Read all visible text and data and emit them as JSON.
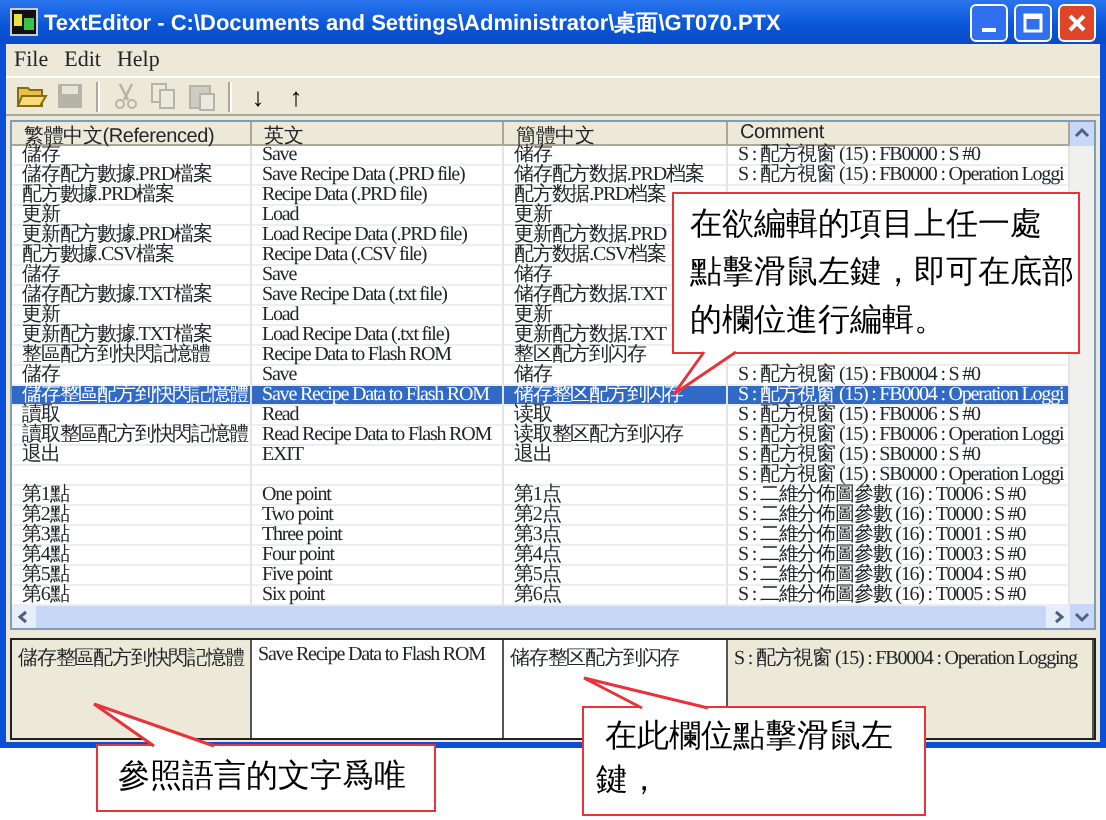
{
  "window": {
    "title": "TextEditor - C:\\Documents and Settings\\Administrator\\桌面\\GT070.PTX"
  },
  "menu": [
    {
      "label": "File"
    },
    {
      "label": "Edit"
    },
    {
      "label": "Help"
    }
  ],
  "toolbar": [
    {
      "kind": "open",
      "disabled": false
    },
    {
      "kind": "save",
      "disabled": true
    },
    {
      "kind": "separator"
    },
    {
      "kind": "cut",
      "disabled": true
    },
    {
      "kind": "copy",
      "disabled": true
    },
    {
      "kind": "paste",
      "disabled": true
    },
    {
      "kind": "separator"
    },
    {
      "kind": "text",
      "label": "↓",
      "disabled": false
    },
    {
      "kind": "text",
      "label": "↑",
      "disabled": false
    }
  ],
  "table": {
    "columns": [
      "繁體中文(Referenced)",
      "英文",
      "簡體中文",
      "Comment"
    ],
    "rows": [
      {
        "selected": false,
        "ref": "儲存",
        "en": "Save",
        "cn": "储存",
        "comment": "S : 配方視窗 (15) : FB0000 : S #0"
      },
      {
        "selected": false,
        "ref": "儲存配方數據.PRD檔案",
        "en": "Save Recipe Data (.PRD file)",
        "cn": "储存配方数据.PRD档案",
        "comment": "S : 配方視窗 (15) : FB0000 : Operation Loggi"
      },
      {
        "selected": false,
        "ref": "配方數據.PRD檔案",
        "en": "Recipe Data (.PRD file)",
        "cn": "配方数据.PRD档案"
      },
      {
        "selected": false,
        "ref": "更新",
        "en": "Load",
        "cn": "更新"
      },
      {
        "selected": false,
        "ref": "更新配方數據.PRD檔案",
        "en": "Load Recipe Data (.PRD file)",
        "cn": "更新配方数据.PRD"
      },
      {
        "selected": false,
        "ref": "配方數據.CSV檔案",
        "en": "Recipe Data (.CSV file)",
        "cn": "配方数据.CSV档案"
      },
      {
        "selected": false,
        "ref": "儲存",
        "en": "Save",
        "cn": "储存"
      },
      {
        "selected": false,
        "ref": "儲存配方數據.TXT檔案",
        "en": "Save Recipe Data (.txt file)",
        "cn": "储存配方数据.TXT"
      },
      {
        "selected": false,
        "ref": "更新",
        "en": "Load",
        "cn": "更新"
      },
      {
        "selected": false,
        "ref": "更新配方數據.TXT檔案",
        "en": "Load Recipe Data (.txt file)",
        "cn": "更新配方数据.TXT"
      },
      {
        "selected": false,
        "ref": "整區配方到快閃記憶體",
        "en": "Recipe Data to Flash ROM",
        "cn": "整区配方到闪存"
      },
      {
        "selected": false,
        "ref": "儲存",
        "en": "Save",
        "cn": "储存",
        "comment": "S : 配方視窗 (15) : FB0004 : S #0"
      },
      {
        "selected": true,
        "ref": "儲存整區配方到快閃記憶體",
        "en": "Save Recipe Data to Flash ROM",
        "cn": "储存整区配方到闪存",
        "comment": "S : 配方視窗 (15) : FB0004 : Operation Loggi"
      },
      {
        "selected": false,
        "ref": "讀取",
        "en": "Read",
        "cn": "读取",
        "comment": "S : 配方視窗 (15) : FB0006 : S #0"
      },
      {
        "selected": false,
        "ref": "讀取整區配方到快閃記憶體",
        "en": "Read Recipe Data to Flash ROM",
        "cn": "读取整区配方到闪存",
        "comment": "S : 配方視窗 (15) : FB0006 : Operation Loggi"
      },
      {
        "selected": false,
        "ref": "退出",
        "en": "EXIT",
        "cn": "退出",
        "comment": "S : 配方視窗 (15) : SB0000 : S #0"
      },
      {
        "selected": false,
        "comment": "S : 配方視窗 (15) : SB0000 : Operation Loggi"
      },
      {
        "selected": false,
        "ref": "第1點",
        "en": "One point",
        "cn": "第1点",
        "comment": "S : 二維分佈圖參數 (16) : T0006 : S #0"
      },
      {
        "selected": false,
        "ref": "第2點",
        "en": "Two point",
        "cn": "第2点",
        "comment": "S : 二維分佈圖參數 (16) : T0000 : S #0"
      },
      {
        "selected": false,
        "ref": "第3點",
        "en": "Three point",
        "cn": "第3点",
        "comment": "S : 二維分佈圖參數 (16) : T0001 : S #0"
      },
      {
        "selected": false,
        "ref": "第4點",
        "en": "Four point",
        "cn": "第4点",
        "comment": "S : 二維分佈圖參數 (16) : T0003 : S #0"
      },
      {
        "selected": false,
        "ref": "第5點",
        "en": "Five point",
        "cn": "第5点",
        "comment": "S : 二維分佈圖參數 (16) : T0004 : S #0"
      },
      {
        "selected": false,
        "ref": "第6點",
        "en": "Six point",
        "cn": "第6点",
        "comment": "S : 二維分佈圖參數 (16) : T0005 : S #0"
      }
    ]
  },
  "editor": {
    "fields": [
      {
        "value": "儲存整區配方到快閃記憶體",
        "readonly": true
      },
      {
        "value": "Save Recipe Data to Flash ROM",
        "readonly": false
      },
      {
        "value": "储存整区配方到闪存",
        "readonly": false
      },
      {
        "value": "S : 配方視窗 (15) : FB0004 : Operation Logging",
        "readonly": true
      }
    ]
  },
  "callouts": [
    {
      "lines": [
        "在欲編輯的項目上任一處",
        "點擊滑鼠左鍵，即可在底部",
        "的欄位進行編輯。"
      ]
    },
    {
      "lines": [
        "參照語言的文字爲唯"
      ]
    },
    {
      "lines": [
        " 在此欄位點擊滑鼠左",
        "鍵，"
      ]
    }
  ]
}
